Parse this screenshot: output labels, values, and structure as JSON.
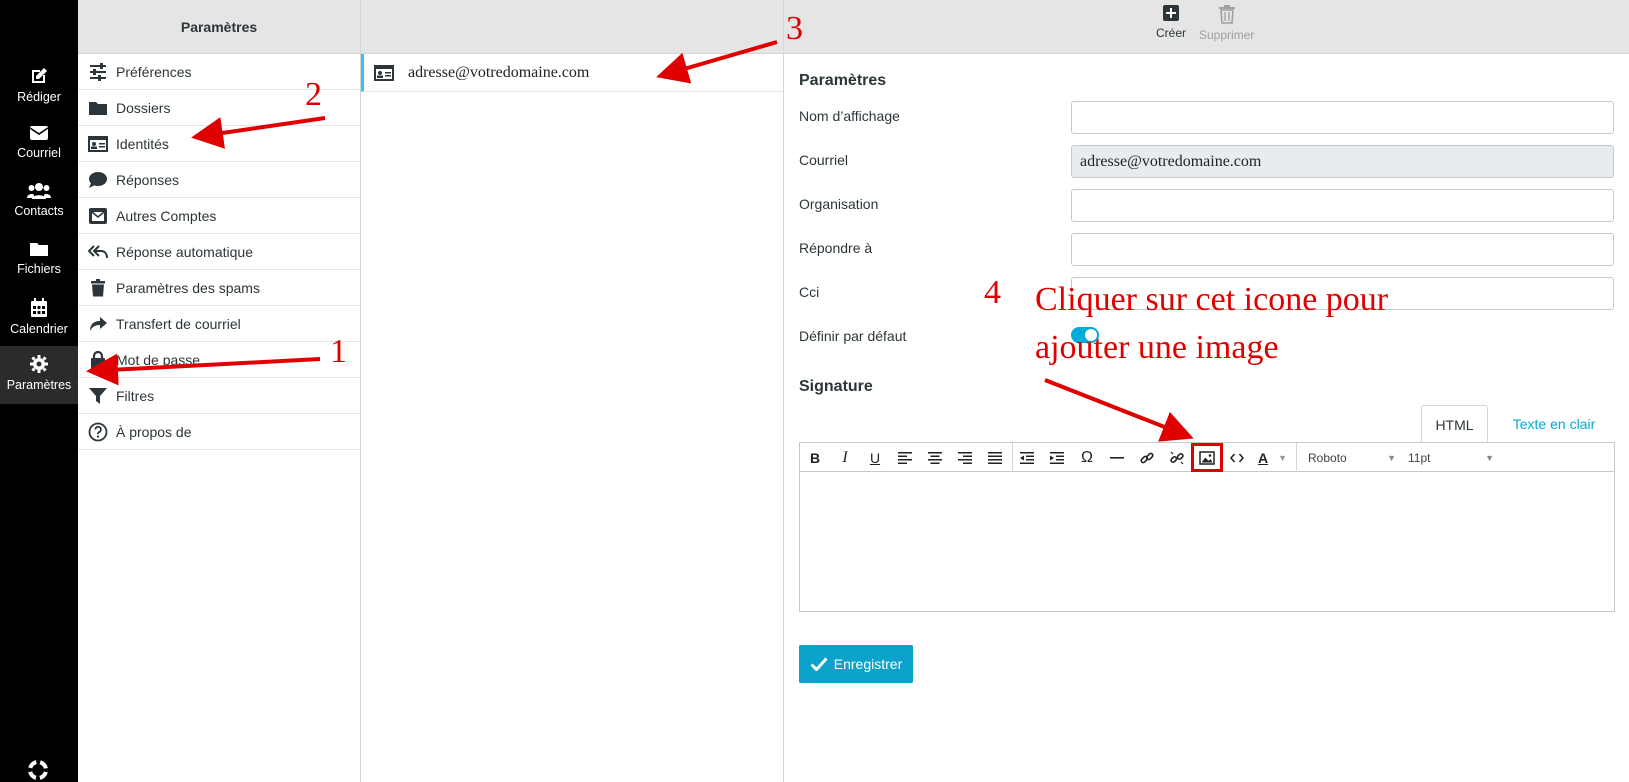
{
  "nav": {
    "items": [
      {
        "label": "Rédiger",
        "icon": "compose-icon"
      },
      {
        "label": "Courriel",
        "icon": "mail-icon"
      },
      {
        "label": "Contacts",
        "icon": "contacts-icon"
      },
      {
        "label": "Fichiers",
        "icon": "folder-icon"
      },
      {
        "label": "Calendrier",
        "icon": "calendar-icon"
      },
      {
        "label": "Paramètres",
        "icon": "gear-icon",
        "active": true
      }
    ],
    "support_icon": "lifebuoy-icon"
  },
  "settings": {
    "header": "Paramètres",
    "items": [
      {
        "label": "Préférences",
        "icon": "sliders-icon"
      },
      {
        "label": "Dossiers",
        "icon": "folder-icon"
      },
      {
        "label": "Identités",
        "icon": "id-card-icon"
      },
      {
        "label": "Réponses",
        "icon": "speech-bubble-icon"
      },
      {
        "label": "Autres Comptes",
        "icon": "envelope-square-icon"
      },
      {
        "label": "Réponse automatique",
        "icon": "reply-all-icon"
      },
      {
        "label": "Paramètres des spams",
        "icon": "trash-icon"
      },
      {
        "label": "Transfert de courriel",
        "icon": "forward-icon"
      },
      {
        "label": "Mot de passe",
        "icon": "lock-icon"
      },
      {
        "label": "Filtres",
        "icon": "filter-icon"
      },
      {
        "label": "À propos de",
        "icon": "question-icon"
      }
    ]
  },
  "identities": {
    "items": [
      {
        "label": "adresse@votredomaine.com",
        "icon": "id-card-icon"
      }
    ]
  },
  "toolbar": {
    "create_label": "Créer",
    "delete_label": "Supprimer"
  },
  "form": {
    "section_title": "Paramètres",
    "fields": {
      "display_name": {
        "label": "Nom d’affichage",
        "value": ""
      },
      "email": {
        "label": "Courriel",
        "value": "adresse@votredomaine.com"
      },
      "organisation": {
        "label": "Organisation",
        "value": ""
      },
      "reply_to": {
        "label": "Répondre à",
        "value": ""
      },
      "bcc": {
        "label": "Cci",
        "value": ""
      }
    },
    "default_label": "Définir par défaut",
    "default_enabled": true,
    "signature_title": "Signature",
    "tabs": {
      "html": "HTML",
      "plain": "Texte en clair"
    },
    "font_family": "Roboto",
    "font_size": "11pt",
    "save_label": "Enregistrer"
  },
  "annotations": {
    "n1": "1",
    "n2": "2",
    "n3": "3",
    "n4": "4",
    "note_line1": "Cliquer sur cet icone pour",
    "note_line2": "ajouter une image",
    "color": "#e00000"
  },
  "colors": {
    "accent": "#00acd8",
    "save_button": "#0ba2cc",
    "nav_bg": "#000000"
  }
}
